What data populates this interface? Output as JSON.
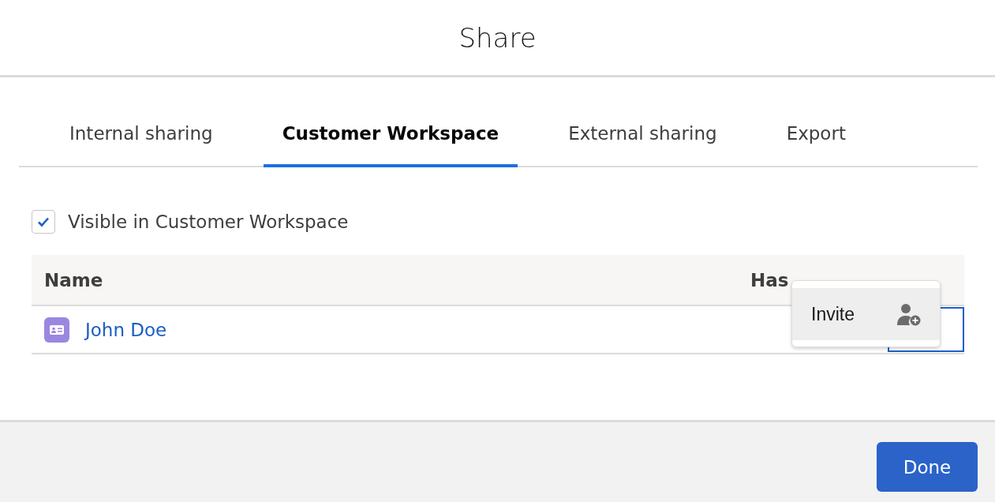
{
  "dialog": {
    "title": "Share"
  },
  "tabs": [
    {
      "label": "Internal sharing",
      "selected": false
    },
    {
      "label": "Customer Workspace",
      "selected": true
    },
    {
      "label": "External sharing",
      "selected": false
    },
    {
      "label": "Export",
      "selected": false
    }
  ],
  "visibility": {
    "label": "Visible in Customer Workspace",
    "checked": true
  },
  "table": {
    "columns": [
      "Name",
      "Has"
    ],
    "rows": [
      {
        "name": "John Doe"
      }
    ]
  },
  "menu": {
    "items": [
      {
        "label": "Invite",
        "highlighted": true
      }
    ]
  },
  "footer": {
    "buttons": [
      "Done"
    ]
  }
}
